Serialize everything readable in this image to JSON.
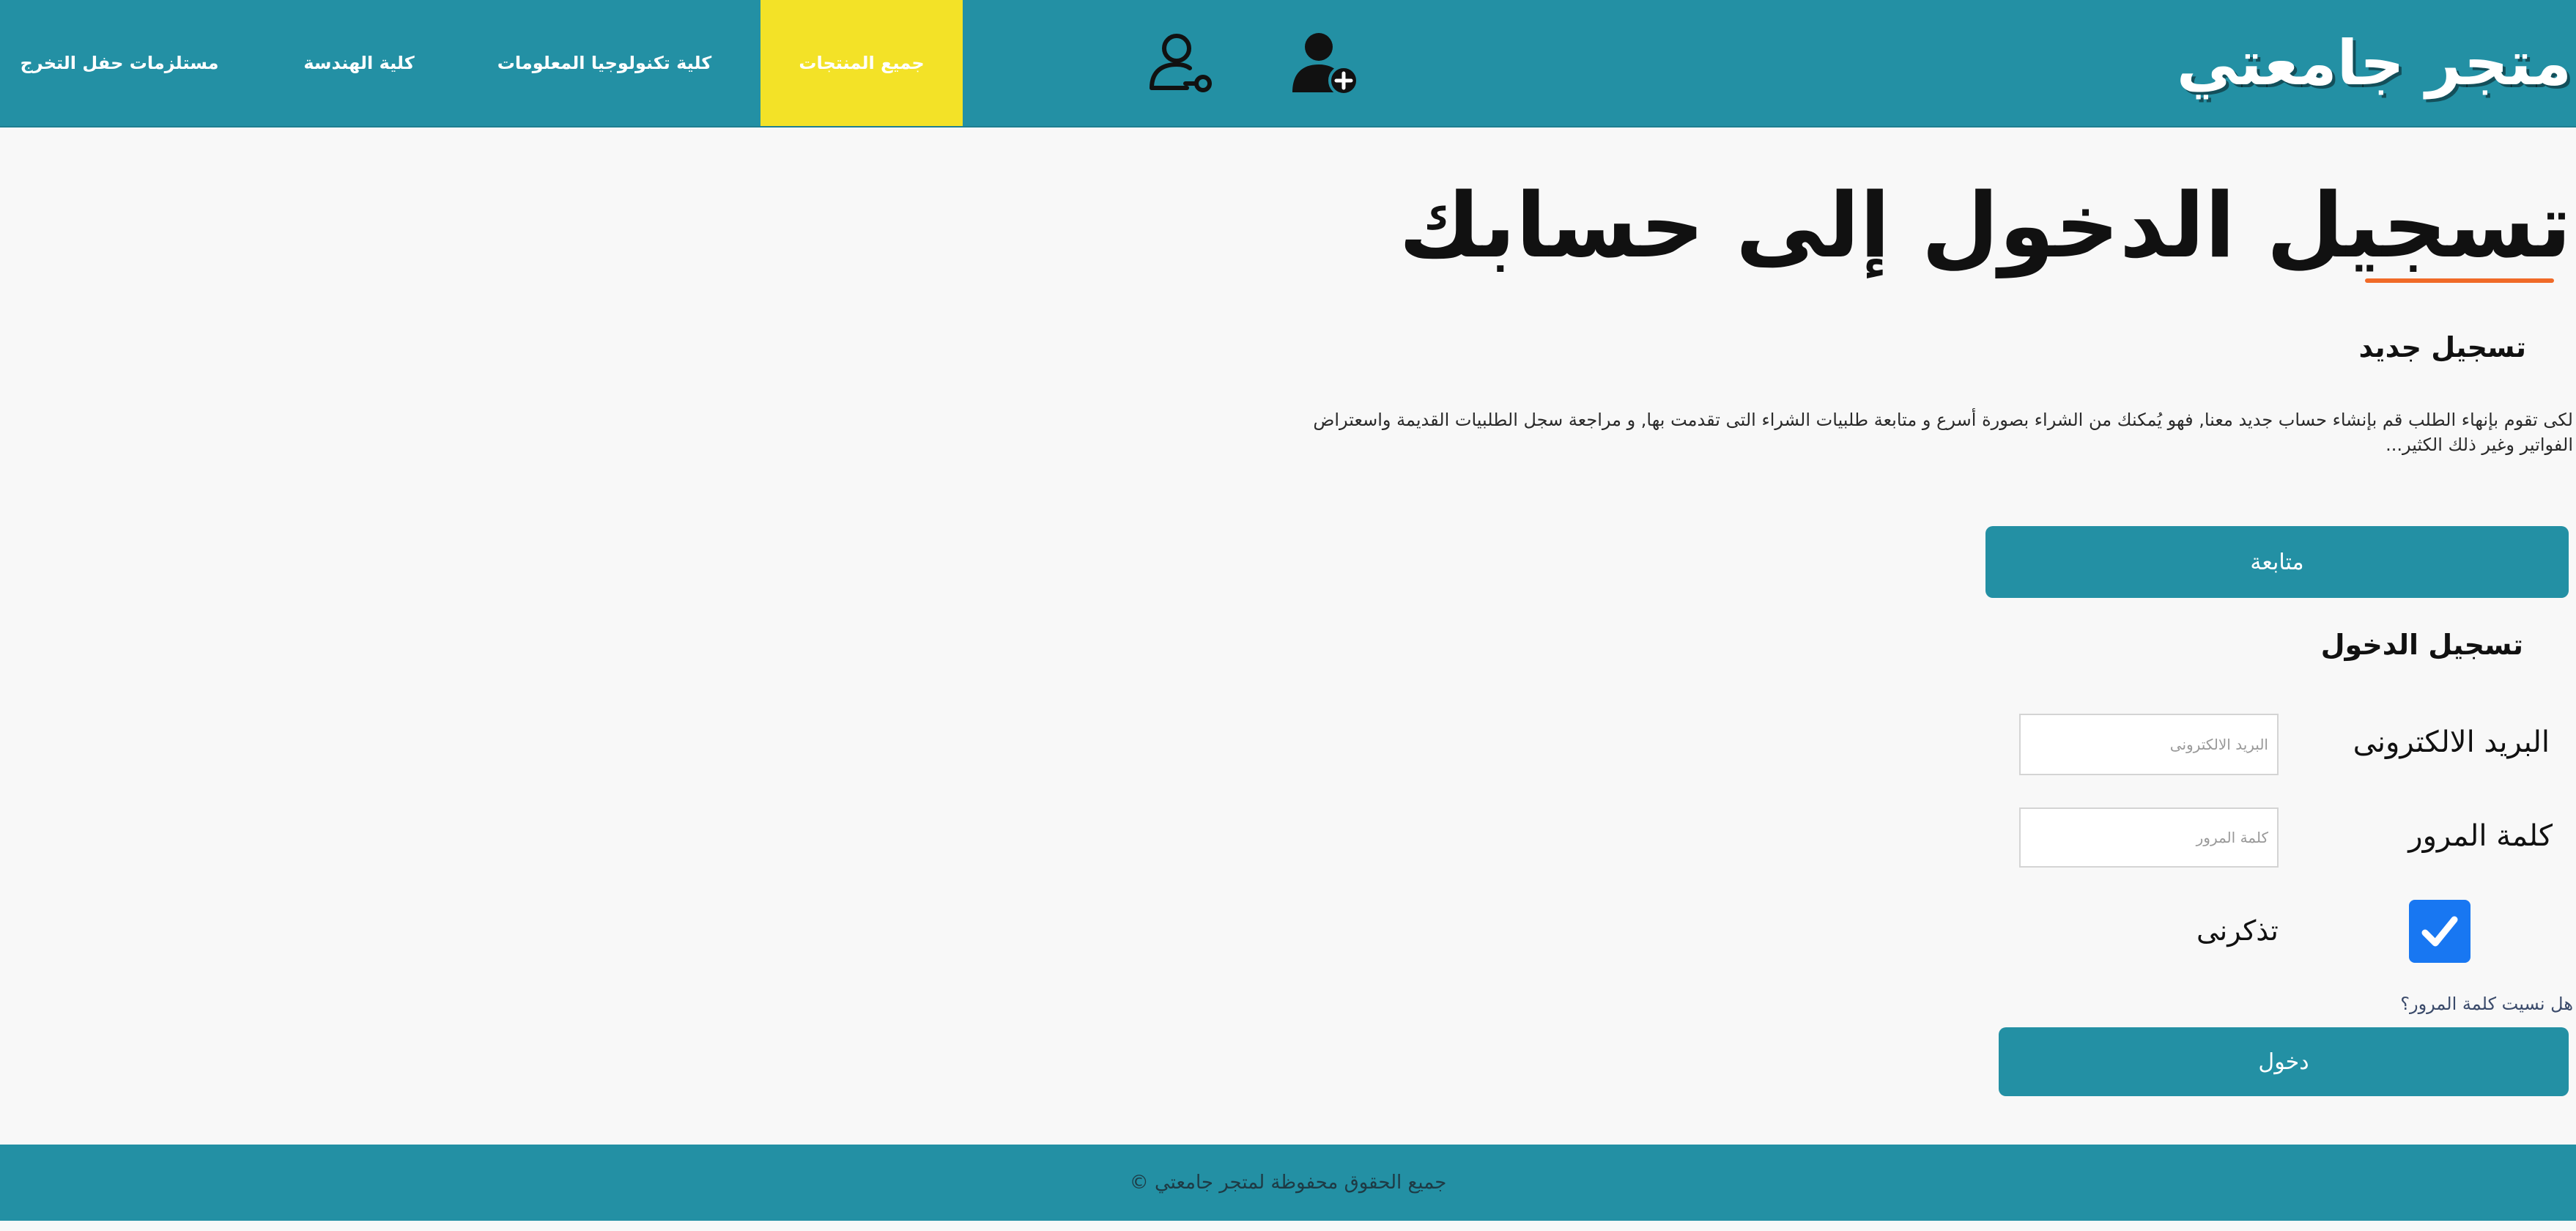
{
  "header": {
    "brand": "متجر جامعتي",
    "nav": [
      {
        "label": "مستلزمات حفل التخرج"
      },
      {
        "label": "كلية الهندسة"
      },
      {
        "label": "كلية تكنولوجيا المعلومات"
      },
      {
        "label": "جميع المنتجات",
        "active": true
      }
    ],
    "icons": [
      "user-key-icon",
      "add-user-icon"
    ]
  },
  "main": {
    "heading": "تسجيل الدخول إلى حسابك",
    "register": {
      "title": "تسجيل جديد",
      "description": "لكى تقوم بإنهاء الطلب قم بإنشاء حساب جديد معنا, فهو يُمكنك من الشراء بصورة أسرع و متابعة طلبيات الشراء التى تقدمت بها, و مراجعة سجل الطلبيات القديمة واسعتراض الفواتير وغير ذلك الكثير...",
      "continue_label": "متابعة"
    },
    "login": {
      "title": "تسجيل الدخول",
      "email_label": "البريد الالكترونى",
      "email_placeholder": "البريد الالكترونى",
      "password_label": "كلمة المرور",
      "password_placeholder": "كلمة المرور",
      "remember_label": "تذكرنى",
      "remember_checked": true,
      "forgot_label": "هل نسيت كلمة المرور؟",
      "submit_label": "دخول"
    }
  },
  "footer": {
    "text": "جميع الحقوق محفوظة لمتجر جامعتي ©"
  },
  "colors": {
    "primary": "#2390a4",
    "active_nav": "#f3e227",
    "accent_underline": "#f06a28",
    "checkbox": "#1877f2",
    "background": "#f8f8f8"
  }
}
